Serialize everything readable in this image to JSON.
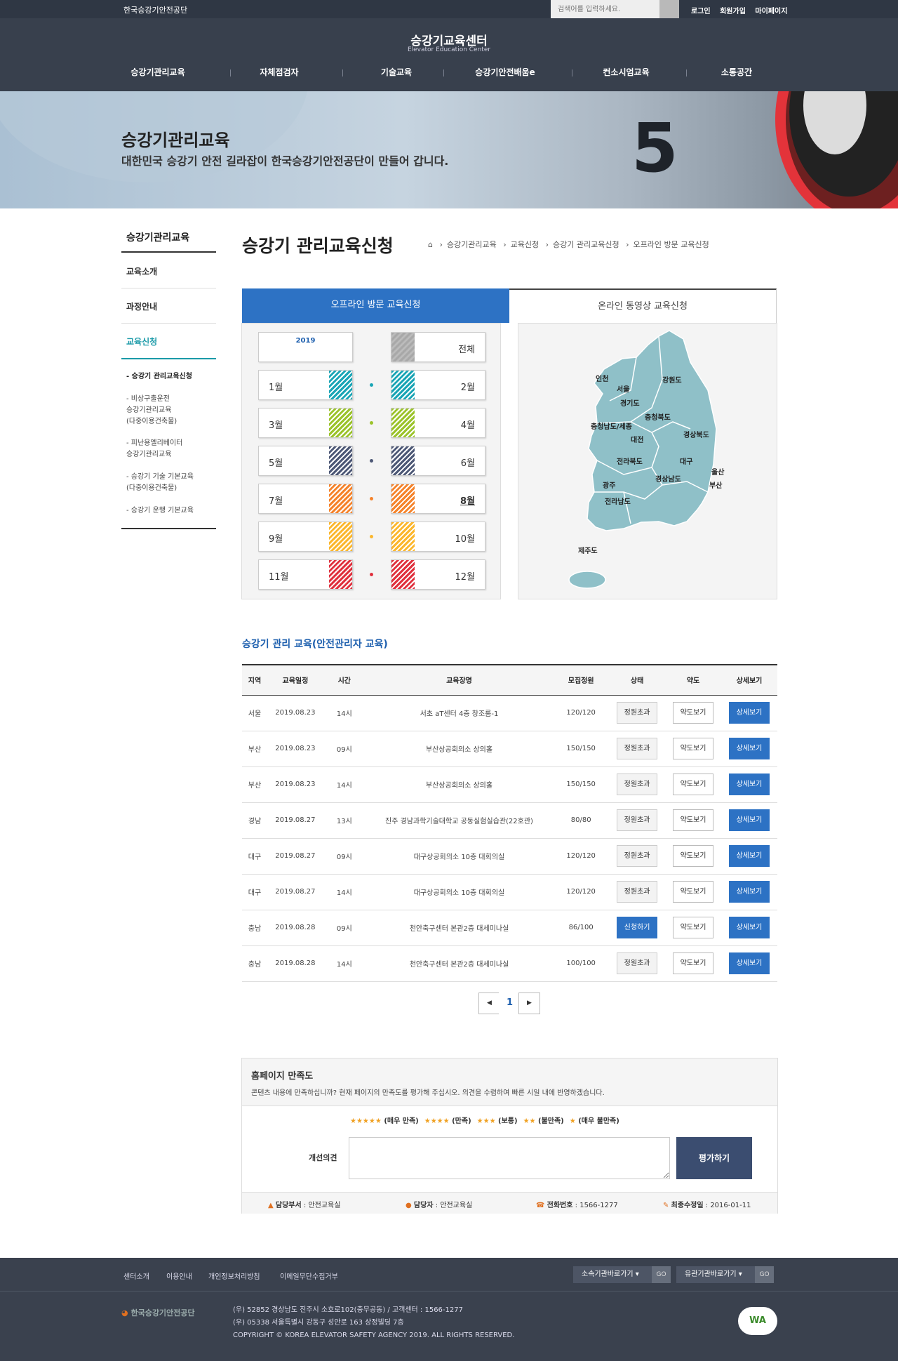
{
  "top": {
    "org": "한국승강기안전공단",
    "search_placeholder": "검색어를 입력하세요.",
    "links": [
      "로그인",
      "회원가입",
      "마이페이지"
    ]
  },
  "header": {
    "logo_kr": "승강기교육센터",
    "logo_en": "Elevator Education Center",
    "nav": [
      "승강기관리교육",
      "자체점검자",
      "기술교육",
      "승강기안전배움e",
      "컨소시엄교육",
      "소통공간"
    ]
  },
  "banner": {
    "title": "승강기관리교육",
    "desc": "대한민국 승강기 안전 길라잡이 한국승강기안전공단이 만들어 갑니다.",
    "floor": "5"
  },
  "lnb": {
    "title": "승강기관리교육",
    "items": [
      "교육소개",
      "과정안내",
      "교육신청"
    ],
    "subs": [
      "- 승강기 관리교육신청",
      "- 비상구출운전\n승강기관리교육\n(다중이용건축물)",
      "- 피난용엘리베이터\n승강기관리교육",
      "- 승강기 기술 기본교육\n(다중이용건축물)",
      "- 승강기 운행 기본교육"
    ]
  },
  "page": {
    "title": "승강기 관리교육신청",
    "breadcrumb": [
      "승강기관리교육",
      "교육신청",
      "승강기 관리교육신청",
      "오프라인 방문 교육신청"
    ]
  },
  "tabs": [
    "오프라인 방문 교육신청",
    "온라인 동영상 교육신청"
  ],
  "months": {
    "year": "2019",
    "all": "전체",
    "labels": [
      "1월",
      "2월",
      "3월",
      "4월",
      "5월",
      "6월",
      "7월",
      "8월",
      "9월",
      "10월",
      "11월",
      "12월"
    ],
    "colors": [
      "#1aa5b5",
      "#9bc32a",
      "#4d5876",
      "#f5832b",
      "#fbb72e",
      "#e0313e"
    ],
    "selected": "8월"
  },
  "map": {
    "regions": [
      "인천",
      "서울",
      "경기도",
      "강원도",
      "충청북도",
      "충청남도/세종",
      "대전",
      "경상북도",
      "대구",
      "울산",
      "전라북도",
      "경상남도",
      "부산",
      "광주",
      "전라남도",
      "제주도"
    ]
  },
  "table": {
    "title": "승강기 관리 교육(안전관리자 교육)",
    "headers": [
      "지역",
      "교육일정",
      "시간",
      "교육장명",
      "모집정원",
      "상태",
      "약도",
      "상세보기"
    ],
    "rows": [
      {
        "region": "서울",
        "date": "2019.08.23",
        "time": "14시",
        "place": "서초 aT센터 4층 창조룸-1",
        "quota": "120/120",
        "status": "정원초과",
        "map": "약도보기",
        "detail": "상세보기"
      },
      {
        "region": "부산",
        "date": "2019.08.23",
        "time": "09시",
        "place": "부산상공회의소 상의홀",
        "quota": "150/150",
        "status": "정원초과",
        "map": "약도보기",
        "detail": "상세보기"
      },
      {
        "region": "부산",
        "date": "2019.08.23",
        "time": "14시",
        "place": "부산상공회의소 상의홀",
        "quota": "150/150",
        "status": "정원초과",
        "map": "약도보기",
        "detail": "상세보기"
      },
      {
        "region": "경남",
        "date": "2019.08.27",
        "time": "13시",
        "place": "진주 경남과학기술대학교 공동실험실습관(22호관)",
        "quota": "80/80",
        "status": "정원초과",
        "map": "약도보기",
        "detail": "상세보기"
      },
      {
        "region": "대구",
        "date": "2019.08.27",
        "time": "09시",
        "place": "대구상공회의소 10층 대회의실",
        "quota": "120/120",
        "status": "정원초과",
        "map": "약도보기",
        "detail": "상세보기"
      },
      {
        "region": "대구",
        "date": "2019.08.27",
        "time": "14시",
        "place": "대구상공회의소 10층 대회의실",
        "quota": "120/120",
        "status": "정원초과",
        "map": "약도보기",
        "detail": "상세보기"
      },
      {
        "region": "충남",
        "date": "2019.08.28",
        "time": "09시",
        "place": "천안축구센터 본관2층 대세미나실",
        "quota": "86/100",
        "status": "신청하기",
        "map": "약도보기",
        "detail": "상세보기"
      },
      {
        "region": "충남",
        "date": "2019.08.28",
        "time": "14시",
        "place": "천안축구센터 본관2층 대세미나실",
        "quota": "100/100",
        "status": "정원초과",
        "map": "약도보기",
        "detail": "상세보기"
      }
    ]
  },
  "pager": {
    "prev": "◀",
    "current": "1",
    "next": "▶"
  },
  "satisfaction": {
    "title": "홈페이지 만족도",
    "desc": "콘텐츠 내용에 만족하십니까? 현재 페이지의 만족도를 평가해 주십시오. 의견을 수렴하여 빠른 시일 내에 반영하겠습니다.",
    "ratings": [
      {
        "stars": "★★★★★",
        "label": "(매우 만족)"
      },
      {
        "stars": "★★★★",
        "label": "(만족)"
      },
      {
        "stars": "★★★",
        "label": "(보통)"
      },
      {
        "stars": "★★",
        "label": "(불만족)"
      },
      {
        "stars": "★",
        "label": "(매우 불만족)"
      }
    ],
    "opinion_label": "개선의견",
    "submit": "평가하기",
    "dept_label": "담당부서",
    "dept": "안전교육실",
    "person_label": "담당자",
    "person": "안전교육실",
    "phone_label": "전화번호",
    "phone": "1566-1277",
    "updated_label": "최종수정일",
    "updated": "2016-01-11"
  },
  "footer": {
    "links": [
      "센터소개",
      "이용안내",
      "개인정보처리방침",
      "이메일무단수집거부"
    ],
    "select1": "소속기관바로가기",
    "select2": "유관기관바로가기",
    "go": "GO",
    "logo": "한국승강기안전공단",
    "addr1": "(우) 52852 경상남도 진주시 소호로102(충무공동) / 고객센터 : 1566-1277",
    "addr2": "(우) 05338 서울특별시 강동구 성안로 163 상정빌딩 7층",
    "copyright": "COPYRIGHT © KOREA ELEVATOR SAFETY AGENCY 2019. ALL RIGHTS RESERVED.",
    "badge": "WA"
  }
}
